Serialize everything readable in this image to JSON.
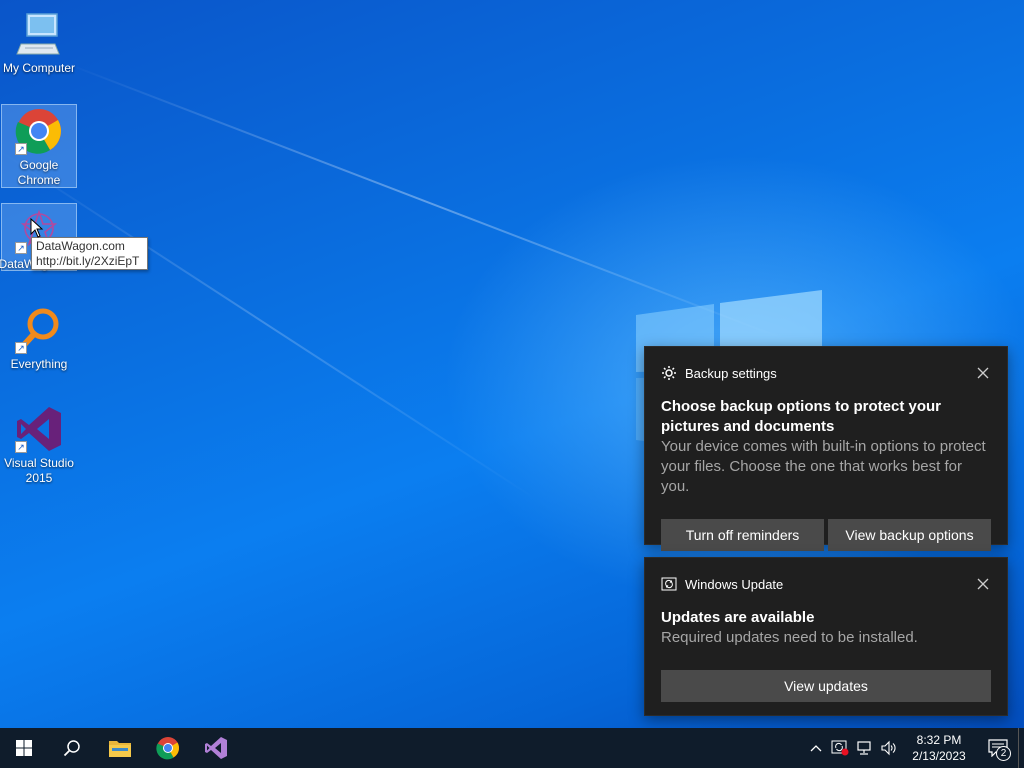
{
  "desktop": {
    "icons": [
      {
        "label": "My Computer",
        "icon": "computer-icon"
      },
      {
        "label": "Google Chrome",
        "icon": "chrome-icon"
      },
      {
        "label": "DataWagon",
        "icon": "datawagon-icon"
      },
      {
        "label": "Everything",
        "icon": "everything-search-icon"
      },
      {
        "label": "Visual Studio 2015",
        "icon": "visual-studio-icon"
      }
    ],
    "tooltip": {
      "line1": "DataWagon.com",
      "line2": "http://bit.ly/2XziEpT"
    }
  },
  "notifications": [
    {
      "app_name": "Backup settings",
      "app_icon": "gear-icon",
      "title": "Choose backup options to protect your pictures and documents",
      "body": "Your device comes with built-in options to protect your files. Choose the one that works best for you.",
      "actions": [
        "Turn off reminders",
        "View backup options"
      ]
    },
    {
      "app_name": "Windows Update",
      "app_icon": "sync-icon",
      "title": "Updates are available",
      "body": "Required updates need to be installed.",
      "actions": [
        "View updates"
      ]
    }
  ],
  "taskbar": {
    "pinned": [
      "start-icon",
      "search-icon",
      "file-explorer-icon",
      "chrome-icon",
      "visual-studio-icon"
    ],
    "clock": {
      "time": "8:32 PM",
      "date": "2/13/2023"
    },
    "notification_count": "2"
  },
  "colors": {
    "accent": "#0078d7",
    "taskbar": "#0f1c2b",
    "toast_bg": "#1f1f1f",
    "toast_button": "#4a4a4a"
  }
}
